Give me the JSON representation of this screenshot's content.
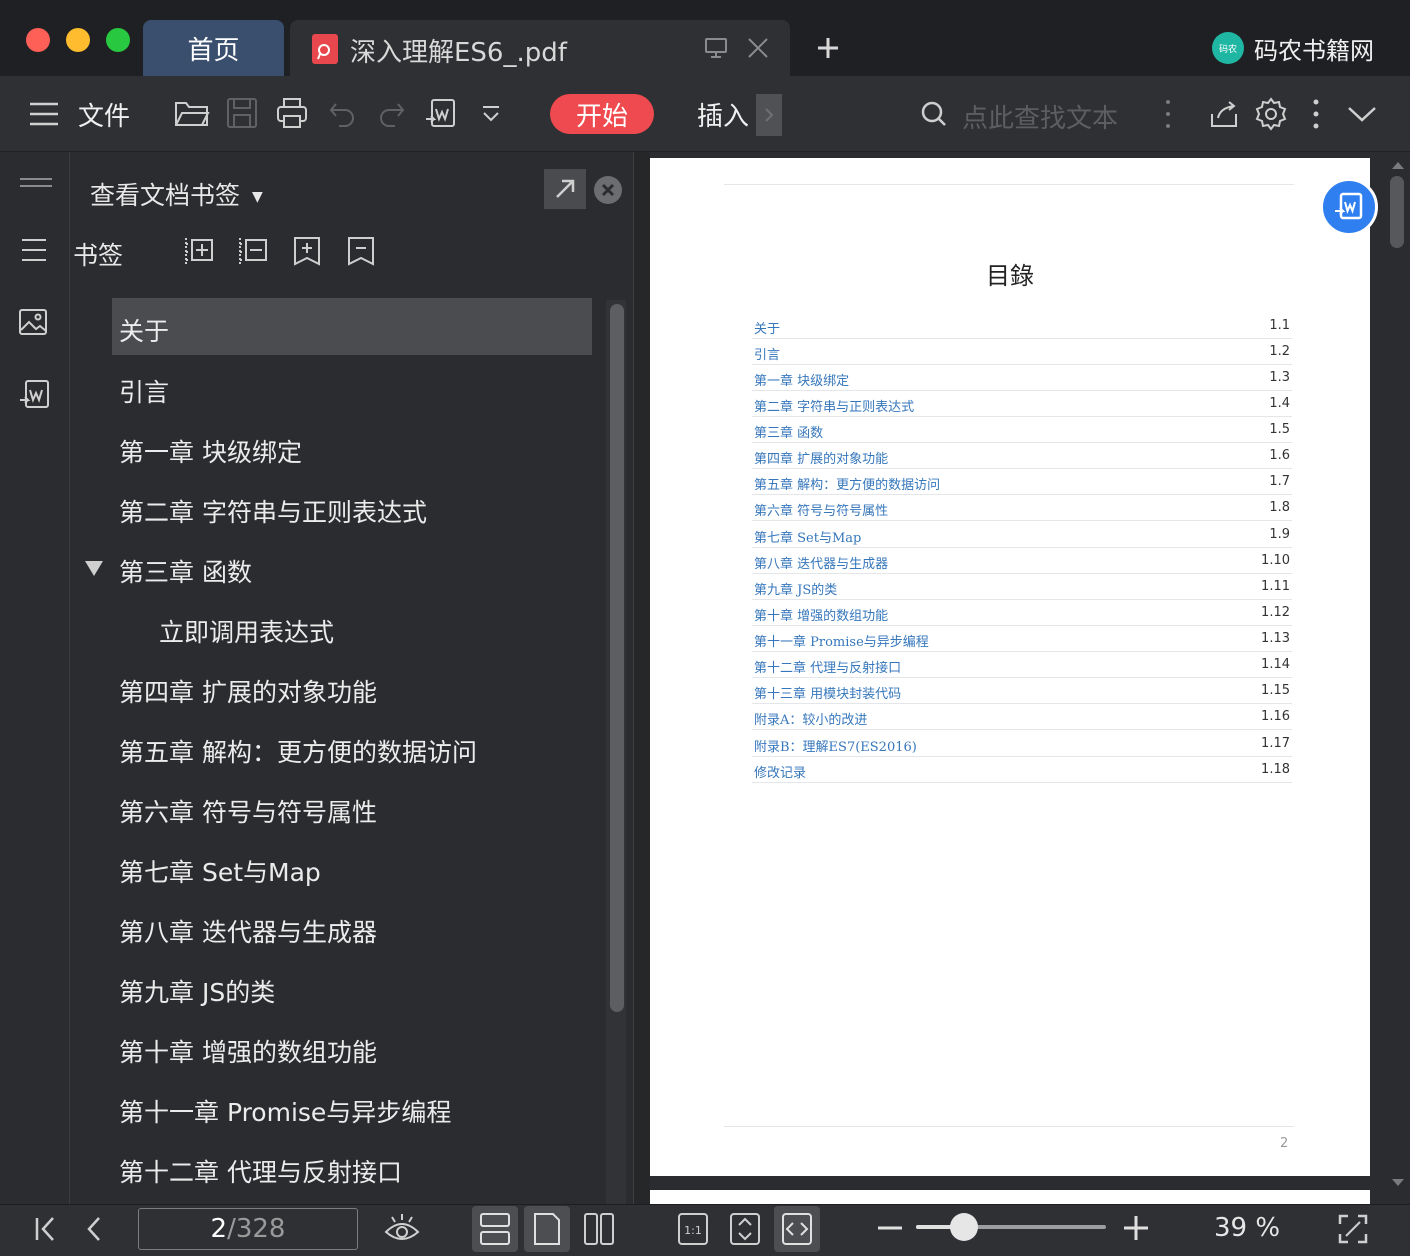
{
  "window": {
    "tabs": [
      {
        "label": "首页",
        "active": false
      },
      {
        "label": "深入理解ES6_.pdf",
        "active": true
      }
    ],
    "brand": {
      "name": "码农书籍网",
      "logo_text": "码农"
    },
    "traffic_colors": {
      "close": "#fe5f57",
      "minimize": "#febc2e",
      "zoom": "#28c840"
    }
  },
  "toolbar": {
    "menu_label": "文件",
    "start_label": "开始",
    "insert_label": "插入",
    "search_placeholder": "点此查找文本",
    "accent_color": "#ef4a4f"
  },
  "bookmarks": {
    "panel_title": "查看文档书签",
    "section_label": "书签",
    "items": [
      {
        "label": "关于",
        "selected": true
      },
      {
        "label": "引言"
      },
      {
        "label": "第一章 块级绑定"
      },
      {
        "label": "第二章 字符串与正则表达式"
      },
      {
        "label": "第三章 函数",
        "expanded": true
      },
      {
        "label": "立即调用表达式",
        "child": true
      },
      {
        "label": "第四章 扩展的对象功能"
      },
      {
        "label": "第五章 解构：更方便的数据访问"
      },
      {
        "label": "第六章 符号与符号属性"
      },
      {
        "label": "第七章 Set与Map"
      },
      {
        "label": "第八章 迭代器与生成器"
      },
      {
        "label": "第九章 JS的类"
      },
      {
        "label": "第十章 增强的数组功能"
      },
      {
        "label": "第十一章 Promise与异步编程"
      },
      {
        "label": "第十二章 代理与反射接口"
      }
    ]
  },
  "document": {
    "toc_title": "目錄",
    "page_number": "2",
    "toc": [
      {
        "label": "关于",
        "num": "1.1"
      },
      {
        "label": "引言",
        "num": "1.2"
      },
      {
        "label": "第一章 块级绑定",
        "num": "1.3"
      },
      {
        "label": "第二章 字符串与正则表达式",
        "num": "1.4"
      },
      {
        "label": "第三章 函数",
        "num": "1.5"
      },
      {
        "label": "第四章 扩展的对象功能",
        "num": "1.6"
      },
      {
        "label": "第五章 解构：更方便的数据访问",
        "num": "1.7"
      },
      {
        "label": "第六章 符号与符号属性",
        "num": "1.8"
      },
      {
        "label": "第七章 Set与Map",
        "num": "1.9"
      },
      {
        "label": "第八章 迭代器与生成器",
        "num": "1.10"
      },
      {
        "label": "第九章 JS的类",
        "num": "1.11"
      },
      {
        "label": "第十章 增强的数组功能",
        "num": "1.12"
      },
      {
        "label": "第十一章 Promise与异步编程",
        "num": "1.13"
      },
      {
        "label": "第十二章 代理与反射接口",
        "num": "1.14"
      },
      {
        "label": "第十三章 用模块封装代码",
        "num": "1.15"
      },
      {
        "label": "附录A：较小的改进",
        "num": "1.16"
      },
      {
        "label": "附录B：理解ES7(ES2016)",
        "num": "1.17"
      },
      {
        "label": "修改记录",
        "num": "1.18"
      }
    ]
  },
  "statusbar": {
    "current_page": "2",
    "separator": "/",
    "total_pages": "328",
    "zoom_label": "39 %",
    "zoom_fraction": 0.25
  }
}
